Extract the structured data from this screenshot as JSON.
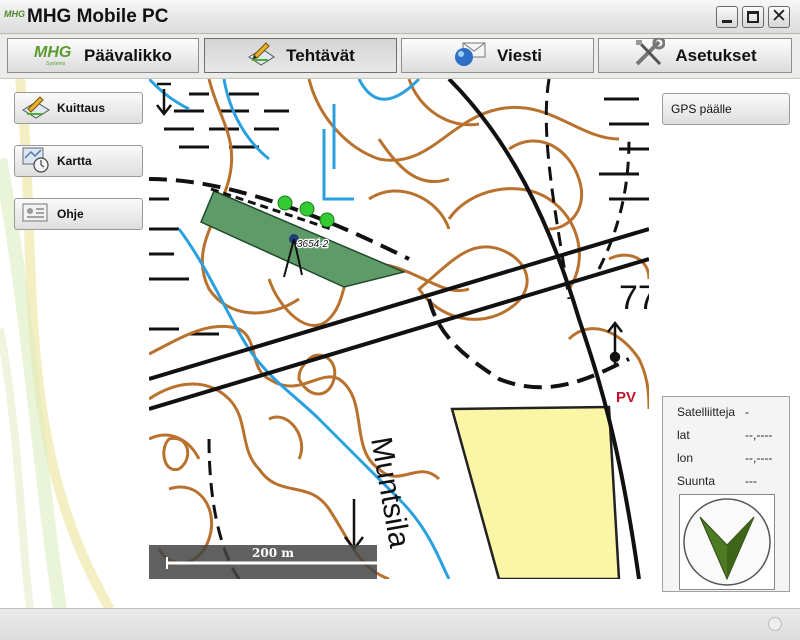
{
  "window": {
    "logo_text": "MHG",
    "title": "MHG Mobile PC"
  },
  "tabs": [
    {
      "label": "Päävalikko",
      "icon": "mhg-logo-icon"
    },
    {
      "label": "Tehtävät",
      "icon": "tasks-icon",
      "active": true
    },
    {
      "label": "Viesti",
      "icon": "message-icon"
    },
    {
      "label": "Asetukset",
      "icon": "settings-icon"
    }
  ],
  "tab_logo": {
    "main": "MHG",
    "sub": "Systems"
  },
  "sidebar": {
    "items": [
      {
        "label": "Kuittaus",
        "icon": "acknowledge-icon"
      },
      {
        "label": "Kartta",
        "icon": "map-icon"
      },
      {
        "label": "Ohje",
        "icon": "help-icon"
      }
    ]
  },
  "map": {
    "field_label": "3654-2",
    "street_label": "Muntsila",
    "marker_label": "PV",
    "number_label": "77",
    "scale_label": "200 m"
  },
  "gps": {
    "button_label": "GPS päälle",
    "satellites_label": "Satelliitteja",
    "satellites_value": "-",
    "lat_label": "lat",
    "lat_value": "--,----",
    "lon_label": "lon",
    "lon_value": "--,----",
    "heading_label": "Suunta",
    "heading_value": "---"
  },
  "colors": {
    "field_green": "#5e9b68",
    "point_green": "#33cc33",
    "contour_brown": "#b8722e",
    "water_blue": "#2aa0e0",
    "field_yellow": "#fbf6a6",
    "compass_arrow": "#4f7a24"
  }
}
